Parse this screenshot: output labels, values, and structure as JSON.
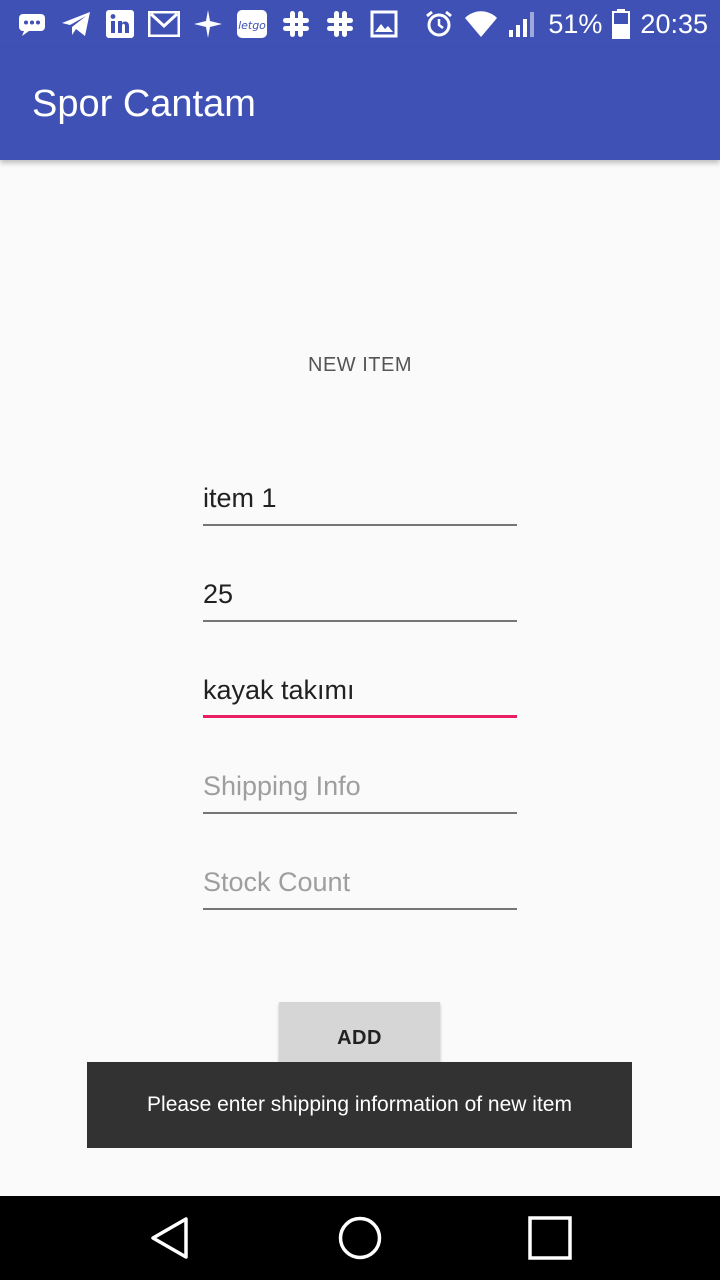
{
  "status_bar": {
    "notification_icons": [
      "messaging-icon",
      "telegram-icon",
      "linkedin-icon",
      "gmail-icon",
      "maps-icon",
      "letgo-icon",
      "slack-icon",
      "slack-icon",
      "gallery-icon"
    ],
    "battery": "51%",
    "time": "20:35"
  },
  "app_bar": {
    "title": "Spor Cantam"
  },
  "form": {
    "title": "NEW ITEM",
    "fields": [
      {
        "name": "item-name-field",
        "value": "item 1",
        "placeholder": ""
      },
      {
        "name": "price-field",
        "value": "25",
        "placeholder": ""
      },
      {
        "name": "description-field",
        "value": "kayak takımı",
        "placeholder": ""
      },
      {
        "name": "shipping-info-field",
        "value": "",
        "placeholder": "Shipping Info"
      },
      {
        "name": "stock-count-field",
        "value": "",
        "placeholder": "Stock Count"
      }
    ],
    "add_label": "ADD"
  },
  "toast": {
    "message": "Please enter shipping information of new item"
  },
  "colors": {
    "primary": "#3f51b5",
    "accent": "#e91e63",
    "background": "#fafafa"
  }
}
